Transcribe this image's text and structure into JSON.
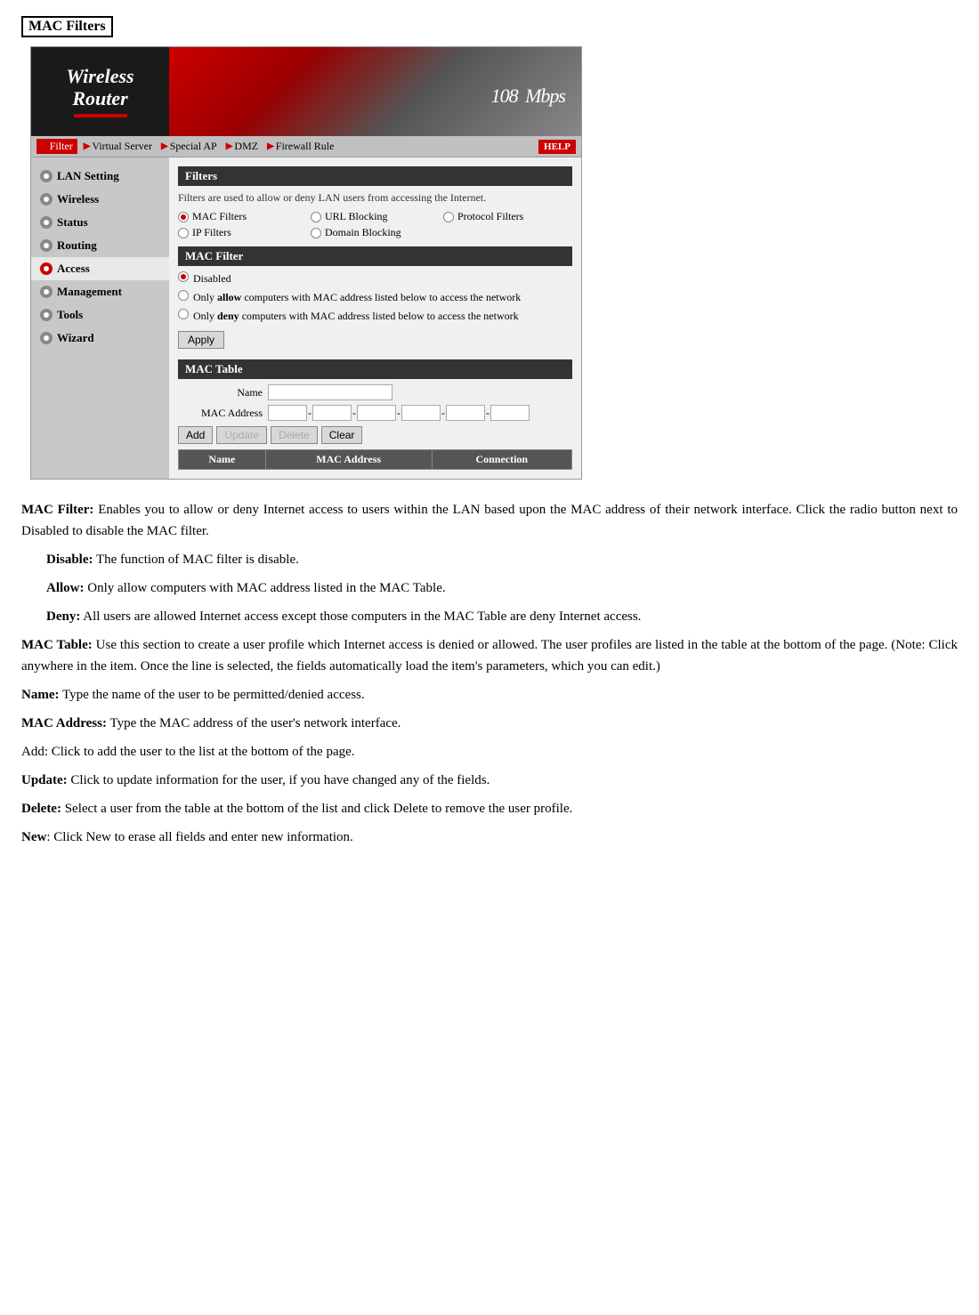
{
  "page": {
    "title": "MAC Filters"
  },
  "router": {
    "logo_line1": "Wireless",
    "logo_line2": "Router",
    "mbps_number": "108",
    "mbps_label": "Mbps"
  },
  "nav": {
    "items": [
      {
        "label": "Filter",
        "active": true
      },
      {
        "label": "Virtual Server"
      },
      {
        "label": "Special AP"
      },
      {
        "label": "DMZ"
      },
      {
        "label": "Firewall Rule"
      }
    ],
    "help_label": "HELP"
  },
  "sidebar": {
    "items": [
      {
        "label": "LAN Setting",
        "color": "gray"
      },
      {
        "label": "Wireless",
        "color": "gray"
      },
      {
        "label": "Status",
        "color": "gray"
      },
      {
        "label": "Routing",
        "color": "gray"
      },
      {
        "label": "Access",
        "color": "red",
        "active": true
      },
      {
        "label": "Management",
        "color": "gray"
      },
      {
        "label": "Tools",
        "color": "gray"
      },
      {
        "label": "Wizard",
        "color": "gray"
      }
    ]
  },
  "filters_section": {
    "header": "Filters",
    "description": "Filters are used to allow or deny LAN users from accessing the Internet.",
    "options": [
      {
        "label": "MAC Filters",
        "selected": true,
        "col": 0
      },
      {
        "label": "URL Blocking",
        "selected": false,
        "col": 1
      },
      {
        "label": "IP Filters",
        "selected": false,
        "col": 0
      },
      {
        "label": "Domain Blocking",
        "selected": false,
        "col": 1
      },
      {
        "label": "Protocol Filters",
        "selected": false,
        "col": 2
      }
    ]
  },
  "mac_filter_section": {
    "header": "MAC Filter",
    "options": [
      {
        "label": "Disabled",
        "selected": true
      },
      {
        "label_prefix": "Only ",
        "label_bold": "allow",
        "label_suffix": " computers with MAC address listed below to access the network",
        "selected": false
      },
      {
        "label_prefix": "Only ",
        "label_bold": "deny",
        "label_suffix": " computers with MAC address listed below to access the network",
        "selected": false
      }
    ],
    "apply_label": "Apply"
  },
  "mac_table_section": {
    "header": "MAC Table",
    "name_label": "Name",
    "mac_label": "MAC Address",
    "buttons": {
      "add": "Add",
      "update": "Update",
      "delete": "Delete",
      "clear": "Clear"
    },
    "columns": [
      "Name",
      "MAC Address",
      "Connection"
    ]
  },
  "description": {
    "mac_filter_title": "MAC Filter:",
    "mac_filter_text": " Enables you to allow or deny Internet access to users within the LAN based upon the MAC address of their network interface. Click the radio button next to Disabled to disable the MAC filter.",
    "disable_term": "Disable:",
    "disable_text": " The function of MAC filter is disable.",
    "allow_term": "Allow:",
    "allow_text": " Only allow computers with MAC address listed in the MAC Table.",
    "deny_term": "Deny:",
    "deny_text": " All users are allowed Internet access except those computers in the MAC Table are deny Internet access.",
    "mac_table_title": "MAC Table:",
    "mac_table_text": " Use this section to create a user profile which Internet access is denied or allowed.  The user profiles are listed in the table at the bottom of the page.  (Note: Click anywhere in the item. Once the line is selected, the fields automatically load the item's parameters, which you can edit.)",
    "name_title": "Name:",
    "name_text": " Type the name of the user to be permitted/denied access.",
    "mac_address_title": "MAC Address:",
    "mac_address_text": " Type the MAC address of the user's network interface.",
    "add_text": "Add: Click to add the user to the list at the bottom of the page.",
    "update_title": "Update:",
    "update_text": " Click to update information for the user, if you have changed any of the fields.",
    "delete_title": "Delete:",
    "delete_text": " Select a user from the table at the bottom of the list and click Delete to remove the user profile.",
    "new_title": "New",
    "new_text": ": Click New to erase all fields and enter new information."
  }
}
